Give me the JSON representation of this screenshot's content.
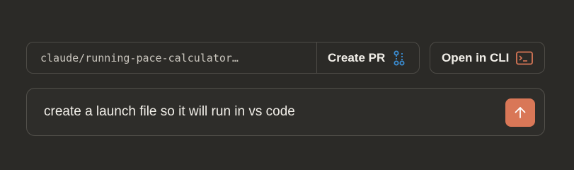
{
  "toolbar": {
    "branch_name": "claude/running-pace-calculator…",
    "create_pr_label": "Create PR",
    "open_cli_label": "Open in CLI"
  },
  "prompt": {
    "text": "create a launch file so it will run in vs code"
  },
  "icons": {
    "create_pr": "git-pull-request-icon",
    "open_cli": "terminal-icon",
    "send": "arrow-up-icon"
  },
  "colors": {
    "background": "#2b2a27",
    "border": "#4d4b46",
    "accent": "#d97757",
    "pr_icon": "#3b8fd6",
    "text": "#f2efe9"
  }
}
